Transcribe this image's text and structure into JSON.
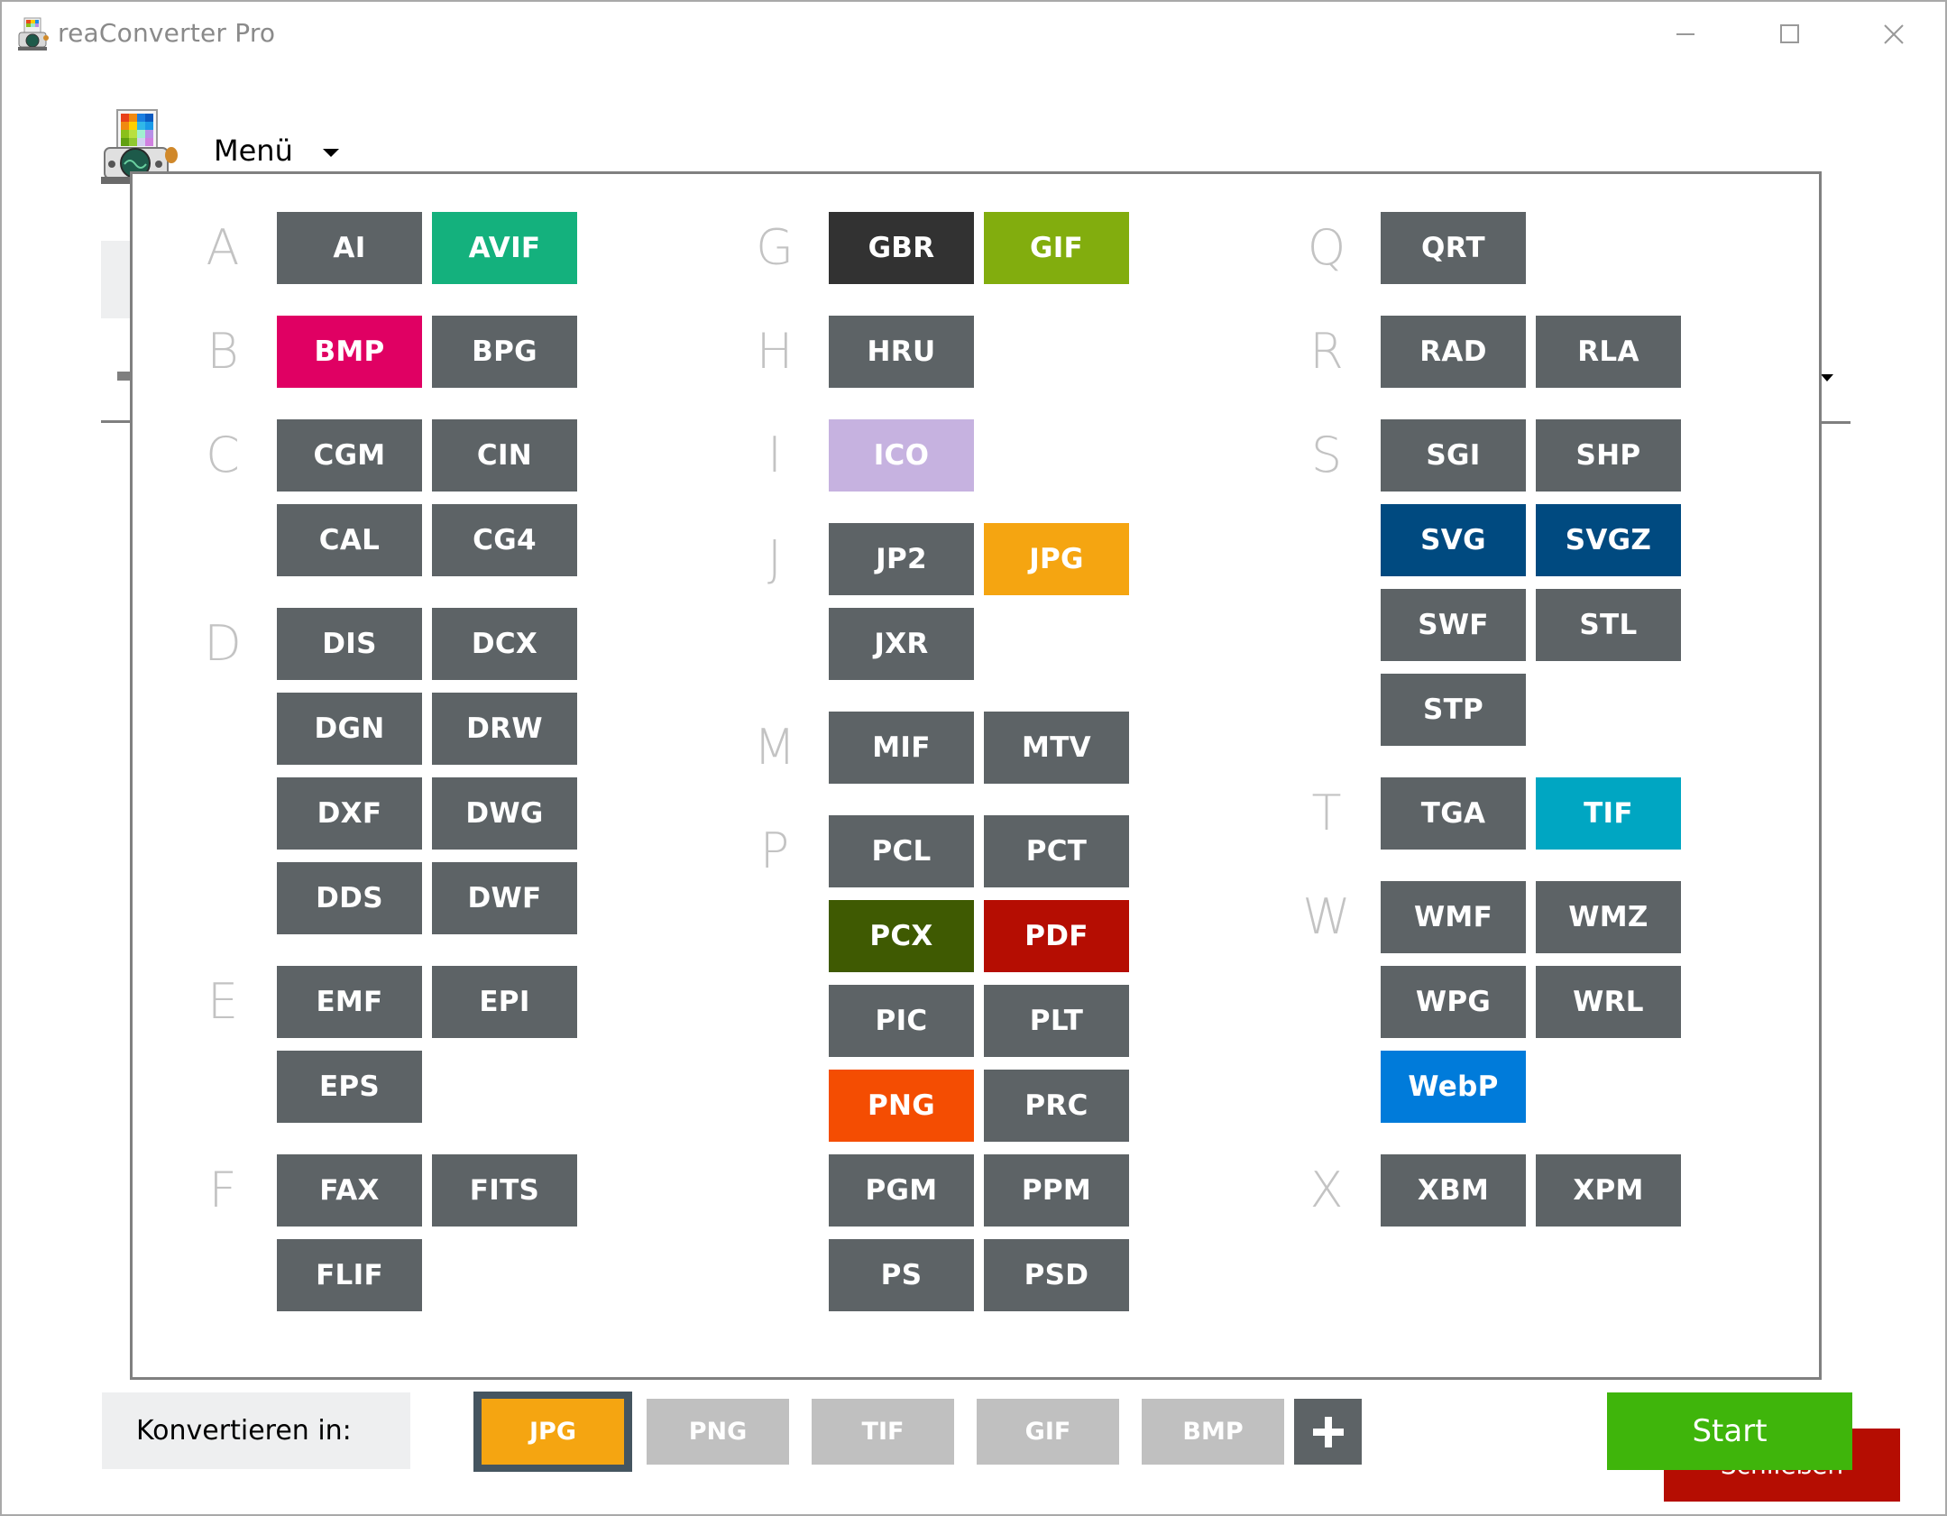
{
  "window": {
    "title": "reaConverter Pro",
    "controls": {
      "minimize": "minimize",
      "maximize": "maximize",
      "close": "close"
    }
  },
  "header": {
    "menu_label": "Menü"
  },
  "colors": {
    "default_format": "#5d6366",
    "letter": "#c3c3c3",
    "close_button": "#b50d02",
    "start_button": "#3fb50b",
    "selected_target": "#f5a511",
    "unselected_target": "#c0c0c0"
  },
  "format_dialog": {
    "columns": [
      {
        "groups": [
          {
            "letter": "A",
            "rows": [
              [
                {
                  "label": "AI"
                },
                {
                  "label": "AVIF",
                  "color": "#14b17d"
                }
              ]
            ]
          },
          {
            "letter": "B",
            "rows": [
              [
                {
                  "label": "BMP",
                  "color": "#e00063"
                },
                {
                  "label": "BPG"
                }
              ]
            ]
          },
          {
            "letter": "C",
            "rows": [
              [
                {
                  "label": "CGM"
                },
                {
                  "label": "CIN"
                }
              ],
              [
                {
                  "label": "CAL"
                },
                {
                  "label": "CG4"
                }
              ]
            ]
          },
          {
            "letter": "D",
            "rows": [
              [
                {
                  "label": "DIS"
                },
                {
                  "label": "DCX"
                }
              ],
              [
                {
                  "label": "DGN"
                },
                {
                  "label": "DRW"
                }
              ],
              [
                {
                  "label": "DXF"
                },
                {
                  "label": "DWG"
                }
              ],
              [
                {
                  "label": "DDS"
                },
                {
                  "label": "DWF"
                }
              ]
            ]
          },
          {
            "letter": "E",
            "rows": [
              [
                {
                  "label": "EMF"
                },
                {
                  "label": "EPI"
                }
              ],
              [
                {
                  "label": "EPS"
                }
              ]
            ]
          },
          {
            "letter": "F",
            "rows": [
              [
                {
                  "label": "FAX"
                },
                {
                  "label": "FITS"
                }
              ],
              [
                {
                  "label": "FLIF"
                }
              ]
            ]
          }
        ]
      },
      {
        "groups": [
          {
            "letter": "G",
            "rows": [
              [
                {
                  "label": "GBR",
                  "color": "#323232"
                },
                {
                  "label": "GIF",
                  "color": "#82ad0e"
                }
              ]
            ]
          },
          {
            "letter": "H",
            "rows": [
              [
                {
                  "label": "HRU"
                }
              ]
            ]
          },
          {
            "letter": "I",
            "rows": [
              [
                {
                  "label": "ICO",
                  "color": "#c6b2e0"
                }
              ]
            ]
          },
          {
            "letter": "J",
            "rows": [
              [
                {
                  "label": "JP2"
                },
                {
                  "label": "JPG",
                  "color": "#f5a511"
                }
              ],
              [
                {
                  "label": "JXR"
                }
              ]
            ]
          },
          {
            "letter": "M",
            "rows": [
              [
                {
                  "label": "MIF"
                },
                {
                  "label": "MTV"
                }
              ]
            ]
          },
          {
            "letter": "P",
            "rows": [
              [
                {
                  "label": "PCL"
                },
                {
                  "label": "PCT"
                }
              ],
              [
                {
                  "label": "PCX",
                  "color": "#3f5a02"
                },
                {
                  "label": "PDF",
                  "color": "#b50d02"
                }
              ],
              [
                {
                  "label": "PIC"
                },
                {
                  "label": "PLT"
                }
              ],
              [
                {
                  "label": "PNG",
                  "color": "#f44d02"
                },
                {
                  "label": "PRC"
                }
              ],
              [
                {
                  "label": "PGM"
                },
                {
                  "label": "PPM"
                }
              ],
              [
                {
                  "label": "PS"
                },
                {
                  "label": "PSD"
                }
              ]
            ]
          }
        ]
      },
      {
        "groups": [
          {
            "letter": "Q",
            "rows": [
              [
                {
                  "label": "QRT"
                }
              ]
            ]
          },
          {
            "letter": "R",
            "rows": [
              [
                {
                  "label": "RAD"
                },
                {
                  "label": "RLA"
                }
              ]
            ]
          },
          {
            "letter": "S",
            "rows": [
              [
                {
                  "label": "SGI"
                },
                {
                  "label": "SHP"
                }
              ],
              [
                {
                  "label": "SVG",
                  "color": "#004a80"
                },
                {
                  "label": "SVGZ",
                  "color": "#004a80"
                }
              ],
              [
                {
                  "label": "SWF"
                },
                {
                  "label": "STL"
                }
              ],
              [
                {
                  "label": "STP"
                }
              ]
            ]
          },
          {
            "letter": "T",
            "rows": [
              [
                {
                  "label": "TGA"
                },
                {
                  "label": "TIF",
                  "color": "#00a6c2"
                }
              ]
            ]
          },
          {
            "letter": "W",
            "rows": [
              [
                {
                  "label": "WMF"
                },
                {
                  "label": "WMZ"
                }
              ],
              [
                {
                  "label": "WPG"
                },
                {
                  "label": "WRL"
                }
              ],
              [
                {
                  "label": "WebP",
                  "color": "#007bda"
                }
              ]
            ]
          },
          {
            "letter": "X",
            "rows": [
              [
                {
                  "label": "XBM"
                },
                {
                  "label": "XPM"
                }
              ]
            ]
          }
        ]
      }
    ],
    "close_label": "Schließen"
  },
  "bottom_bar": {
    "convert_label": "Konvertieren in:",
    "targets": [
      {
        "label": "JPG",
        "selected": true
      },
      {
        "label": "PNG",
        "selected": false
      },
      {
        "label": "TIF",
        "selected": false
      },
      {
        "label": "GIF",
        "selected": false
      },
      {
        "label": "BMP",
        "selected": false
      }
    ],
    "add_icon": "plus-icon",
    "start_label": "Start"
  }
}
